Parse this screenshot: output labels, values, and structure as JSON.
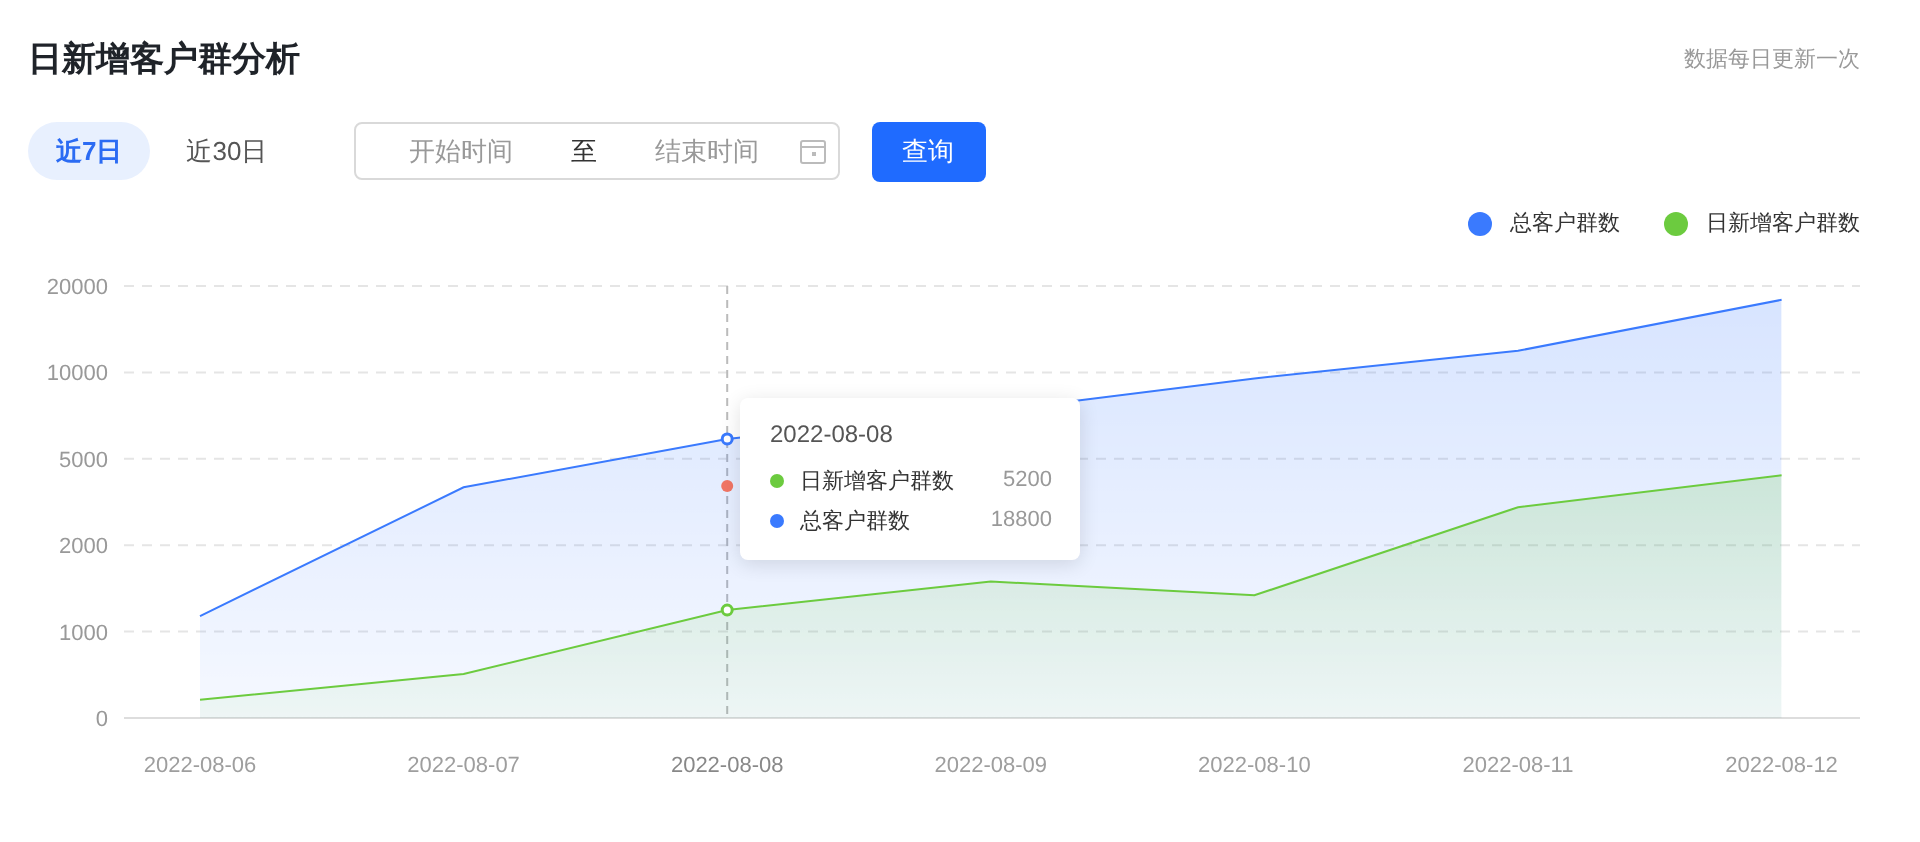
{
  "title": "日新增客户群分析",
  "update_note": "数据每日更新一次",
  "range_tabs": [
    {
      "label": "近7日",
      "selected": true
    },
    {
      "label": "近30日",
      "selected": false
    }
  ],
  "date_range": {
    "start_placeholder": "开始时间",
    "separator": "至",
    "end_placeholder": "结束时间"
  },
  "query_button": "查询",
  "chart": {
    "legend": [
      {
        "name": "总客户群数",
        "color": "#3a7afe"
      },
      {
        "name": "日新增客户群数",
        "color": "#6ccb3f"
      }
    ],
    "y_axis_labels": [
      "20000",
      "10000",
      "5000",
      "2000",
      "1000",
      "0"
    ],
    "x_axis_labels": [
      {
        "text": "2022-08-06",
        "selected": false
      },
      {
        "text": "2022-08-07",
        "selected": false
      },
      {
        "text": "2022-08-08",
        "selected": true
      },
      {
        "text": "2022-08-09",
        "selected": false
      },
      {
        "text": "2022-08-10",
        "selected": false
      },
      {
        "text": "2022-08-11",
        "selected": false
      },
      {
        "text": "2022-08-12",
        "selected": false
      }
    ],
    "tooltip": {
      "date": "2022-08-08",
      "rows": [
        {
          "name": "日新增客户群数",
          "value": "5200",
          "color": "#6ccb3f"
        },
        {
          "name": "总客户群数",
          "value": "18800",
          "color": "#3a7afe"
        }
      ]
    }
  }
}
